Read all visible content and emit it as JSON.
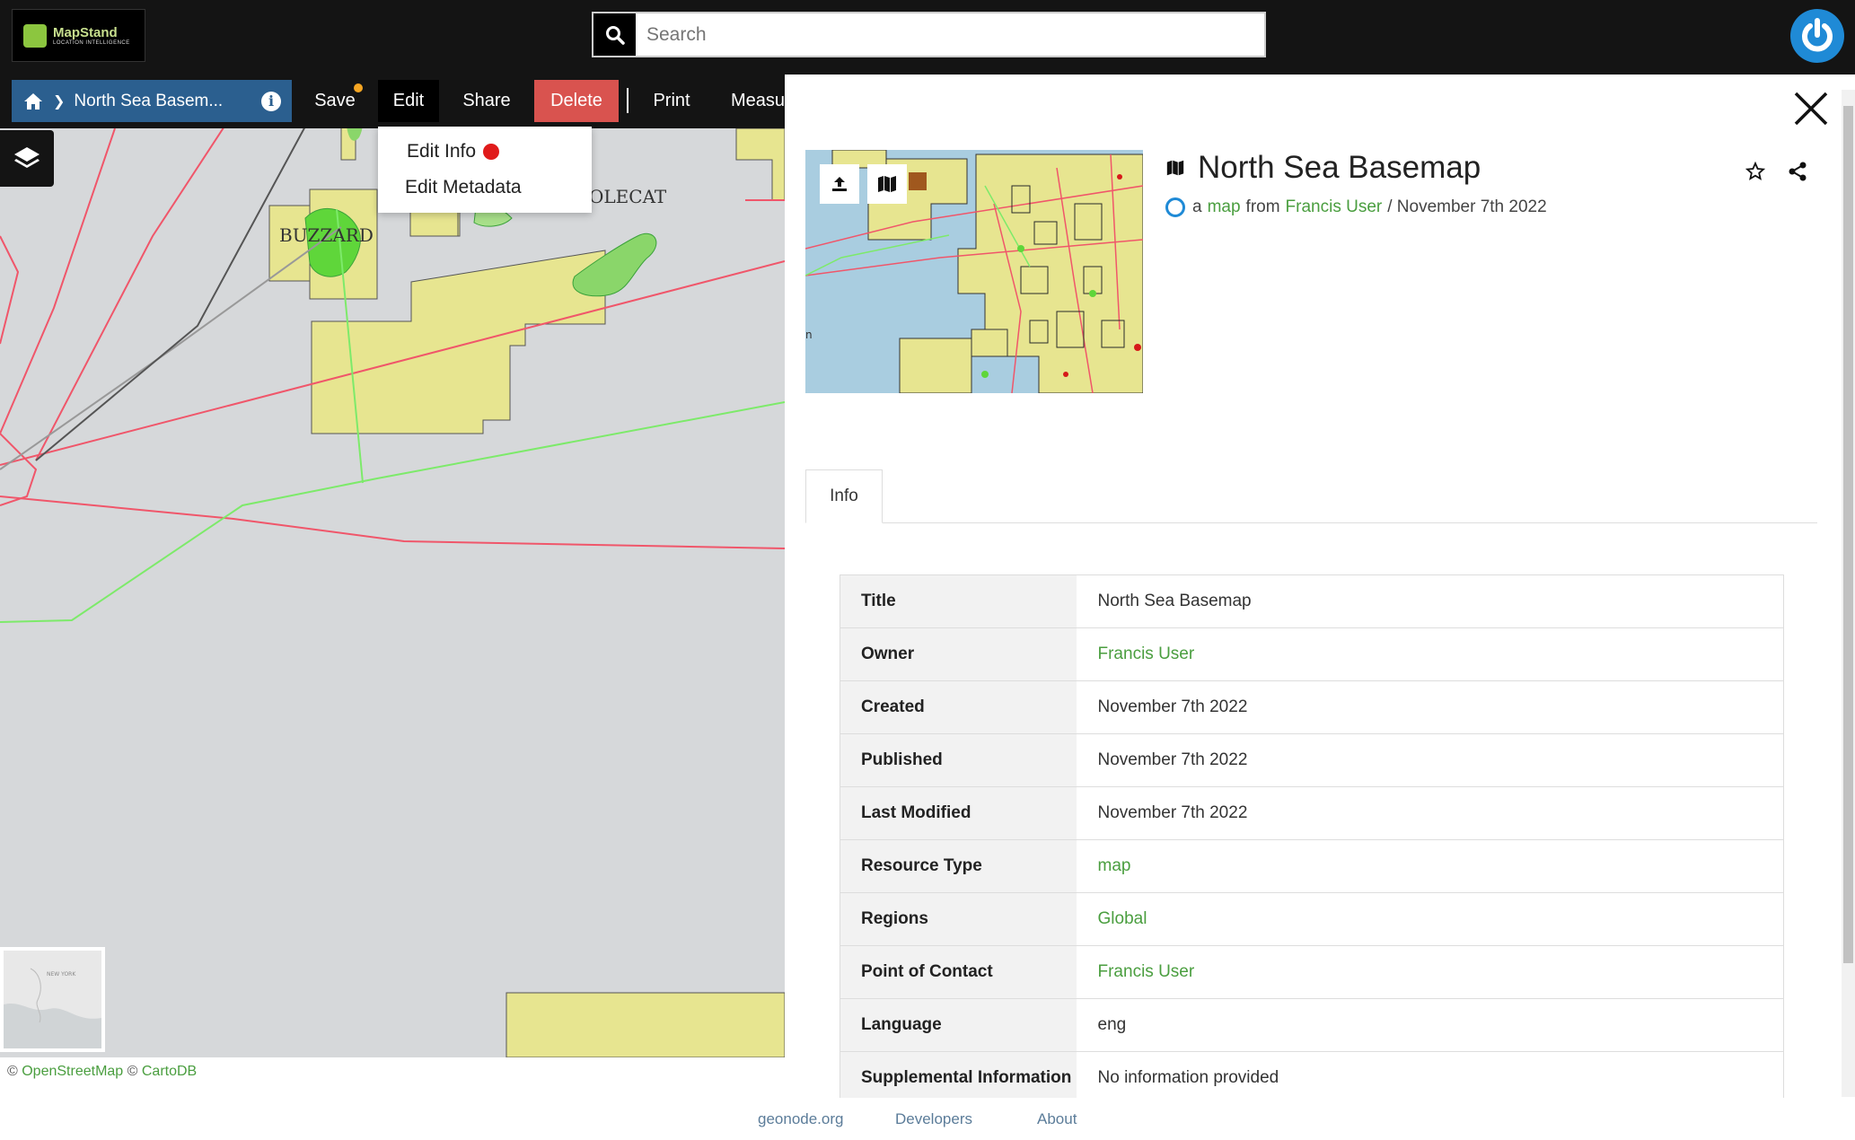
{
  "header": {
    "logo_name": "MapStand",
    "logo_tagline": "LOCATION INTELLIGENCE",
    "search_placeholder": "Search"
  },
  "toolbar": {
    "breadcrumb_title": "North Sea Basem...",
    "save_label": "Save",
    "edit_label": "Edit",
    "share_label": "Share",
    "delete_label": "Delete",
    "print_label": "Print",
    "measure_label": "Measu"
  },
  "edit_menu": {
    "items": [
      "Edit Info",
      "Edit Metadata"
    ]
  },
  "map": {
    "labels": [
      "BUZZARD",
      "OLECAT"
    ],
    "attribution_osm": "OpenStreetMap",
    "attribution_carto": "CartoDB",
    "minimap_label": "NEW YORK"
  },
  "resource": {
    "title": "North Sea Basemap",
    "sub_prefix": "a",
    "type_link": "map",
    "from_word": "from",
    "owner": "Francis User",
    "date": "/ November 7th 2022"
  },
  "tabs": [
    "Info"
  ],
  "info_rows": [
    {
      "key": "Title",
      "value": "North Sea Basemap",
      "link": false
    },
    {
      "key": "Owner",
      "value": "Francis User",
      "link": true
    },
    {
      "key": "Created",
      "value": "November 7th 2022",
      "link": false
    },
    {
      "key": "Published",
      "value": "November 7th 2022",
      "link": false
    },
    {
      "key": "Last Modified",
      "value": "November 7th 2022",
      "link": false
    },
    {
      "key": "Resource Type",
      "value": "map",
      "link": true
    },
    {
      "key": "Regions",
      "value": "Global",
      "link": true
    },
    {
      "key": "Point of Contact",
      "value": "Francis User",
      "link": true
    },
    {
      "key": "Language",
      "value": "eng",
      "link": false
    },
    {
      "key": "Supplemental Information",
      "value": "No information provided",
      "link": false
    }
  ],
  "footer": {
    "links": [
      "geonode.org",
      "Developers",
      "About"
    ]
  },
  "colors": {
    "accent_blue": "#1f8ad6",
    "link_green": "#4a9e3f",
    "delete_red": "#d9534f",
    "toolbar_dark": "#141414"
  }
}
